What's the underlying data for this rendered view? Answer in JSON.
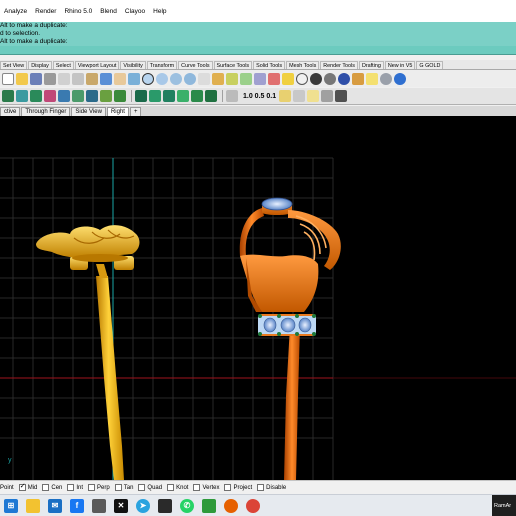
{
  "menu": [
    "Analyze",
    "Render",
    "Rhino 5.0",
    "Blend",
    "Clayoo",
    "Help"
  ],
  "command_history": [
    "Alt to make a duplicate:",
    "d to selection.",
    "Alt to make a duplicate:"
  ],
  "toolbar_tabs": [
    "Set View",
    "Display",
    "Select",
    "Viewport Layout",
    "Visibility",
    "Transform",
    "Curve Tools",
    "Surface Tools",
    "Solid Tools",
    "Mesh Tools",
    "Render Tools",
    "Drafting",
    "New in V5",
    "G GOLD"
  ],
  "toolbar2_numbers": "1.0 0.5 0.1",
  "viewport_tabs": [
    {
      "label": "ctive",
      "active": false
    },
    {
      "label": "Through Finger",
      "active": false
    },
    {
      "label": "Side View",
      "active": false
    },
    {
      "label": "Right",
      "active": true
    },
    {
      "label": "+",
      "active": false
    }
  ],
  "viewport_axis_label": "y",
  "osnaps": [
    {
      "label": "Point",
      "checked": false
    },
    {
      "label": "Mid",
      "checked": true
    },
    {
      "label": "Cen",
      "checked": false
    },
    {
      "label": "Int",
      "checked": false
    },
    {
      "label": "Perp",
      "checked": false
    },
    {
      "label": "Tan",
      "checked": false
    },
    {
      "label": "Quad",
      "checked": false
    },
    {
      "label": "Knot",
      "checked": false
    },
    {
      "label": "Vertex",
      "checked": false
    },
    {
      "label": "Project",
      "checked": false
    },
    {
      "label": "Disable",
      "checked": false
    }
  ],
  "taskbar_tray": "RamAr",
  "colors": {
    "viewport_bg": "#000000",
    "grid": "#3a3a3a",
    "axis_y": "#1aa6a6",
    "axis_x": "#a0141e",
    "gold": "#f0a800",
    "copper": "#e2671a",
    "gem_blue": "#a8c4ee",
    "gem_green": "#1e7a3a"
  }
}
